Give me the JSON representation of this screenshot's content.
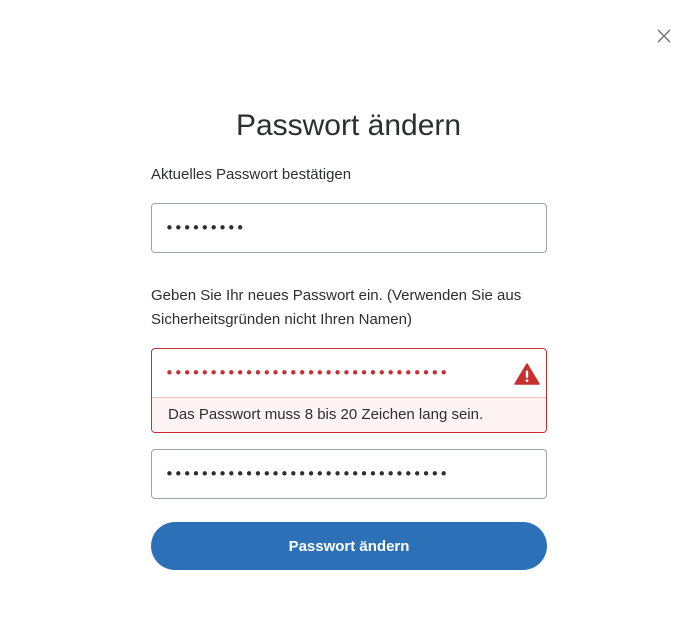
{
  "dialog": {
    "title": "Passwort ändern",
    "close_icon": "close-icon"
  },
  "current_password": {
    "label": "Aktuelles Passwort bestätigen",
    "value": "•••••••••"
  },
  "new_password": {
    "label": "Geben Sie Ihr neues Passwort ein. (Verwenden Sie aus Sicherheitsgründen nicht Ihren Namen)",
    "value": "••••••••••••••••••••••••••••••••",
    "error_icon": "warning-icon",
    "error_message": "Das Passwort muss 8 bis 20 Zeichen lang sein."
  },
  "confirm_password": {
    "value": "••••••••••••••••••••••••••••••••"
  },
  "submit": {
    "label": "Passwort ändern"
  },
  "colors": {
    "primary_button": "#2c70b8",
    "error": "#c72e2e",
    "text": "#2c2e2f"
  }
}
